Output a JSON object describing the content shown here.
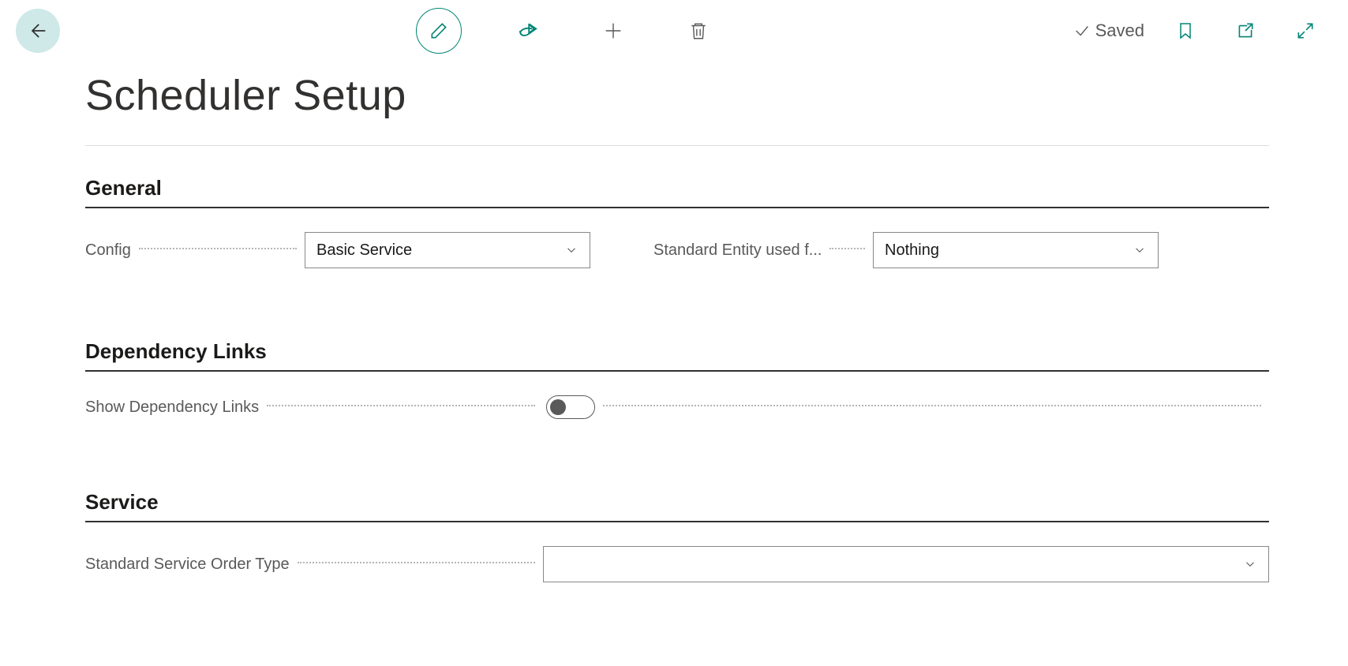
{
  "toolbar": {
    "saved_label": "Saved"
  },
  "page": {
    "title": "Scheduler Setup"
  },
  "sections": {
    "general": {
      "title": "General",
      "config_label": "Config",
      "config_value": "Basic Service",
      "entity_label": "Standard Entity used f...",
      "entity_value": "Nothing"
    },
    "dependency": {
      "title": "Dependency Links",
      "show_links_label": "Show Dependency Links",
      "show_links_value": false
    },
    "service": {
      "title": "Service",
      "order_type_label": "Standard Service Order Type",
      "order_type_value": ""
    }
  }
}
